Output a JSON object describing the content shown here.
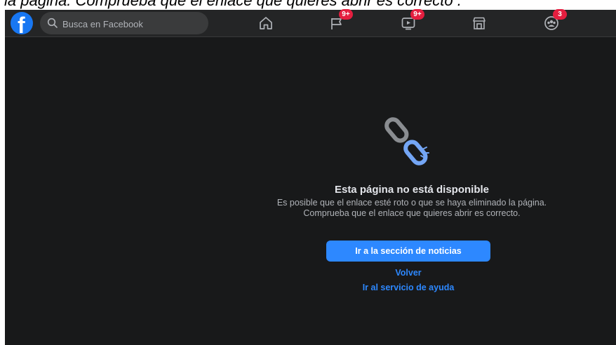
{
  "caption": "la página. Comprueba que el enlace que quieres abrir es correcto .",
  "topbar": {
    "logo": "f",
    "search_placeholder": "Busca en Facebook",
    "nav": [
      {
        "icon": "home-icon",
        "badge": ""
      },
      {
        "icon": "pages-flag-icon",
        "badge": "9+"
      },
      {
        "icon": "watch-video-icon",
        "badge": "9+"
      },
      {
        "icon": "marketplace-icon",
        "badge": ""
      },
      {
        "icon": "groups-icon",
        "badge": "3"
      }
    ]
  },
  "error": {
    "illustration": "broken-link-icon",
    "title": "Esta página no está disponible",
    "description": "Es posible que el enlace esté roto o que se haya eliminado la página. Comprueba que el enlace que quieres abrir es correcto.",
    "primary_button": "Ir a la sección de noticias",
    "back_link": "Volver",
    "help_link": "Ir al servicio de ayuda"
  },
  "colors": {
    "background": "#18191a",
    "topbar": "#242526",
    "accent": "#2d88ff",
    "badge": "#e41e3f"
  }
}
